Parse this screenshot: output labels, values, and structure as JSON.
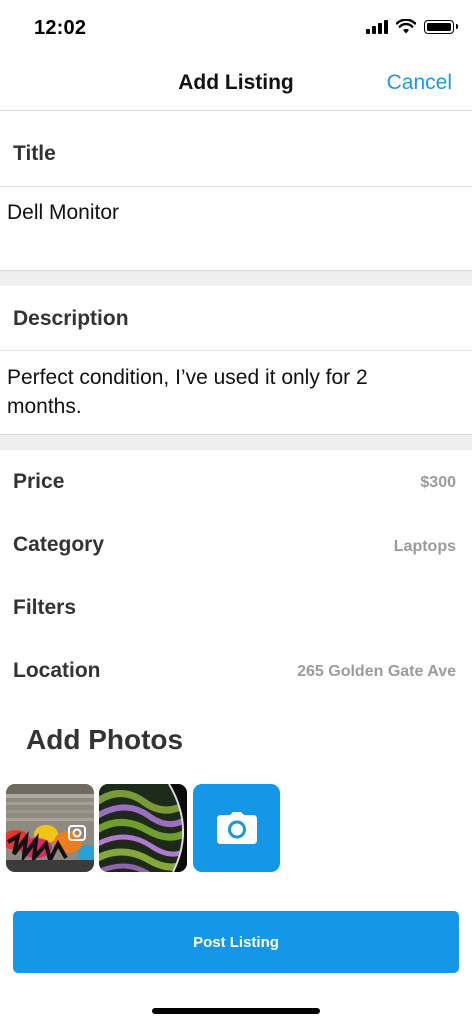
{
  "status_bar": {
    "time": "12:02"
  },
  "nav": {
    "title": "Add Listing",
    "cancel_label": "Cancel"
  },
  "title_section": {
    "label": "Title",
    "value": "Dell Monitor"
  },
  "description_section": {
    "label": "Description",
    "value": "Perfect condition, I’ve used it only for 2 months."
  },
  "details": [
    {
      "label": "Price",
      "value": "$300"
    },
    {
      "label": "Category",
      "value": "Laptops"
    },
    {
      "label": "Filters",
      "value": ""
    },
    {
      "label": "Location",
      "value": "265 Golden Gate Ave"
    }
  ],
  "photos": {
    "title": "Add Photos",
    "items": [
      {
        "icon": "graffiti-photo"
      },
      {
        "icon": "swirl-wallpaper-photo"
      }
    ],
    "add_icon": "camera-icon",
    "accent_color": "#1497e6"
  },
  "post_button": {
    "label": "Post Listing"
  },
  "colors": {
    "link": "#1a9be0",
    "accent": "#1497e6",
    "muted_value": "#9b9b9b"
  }
}
